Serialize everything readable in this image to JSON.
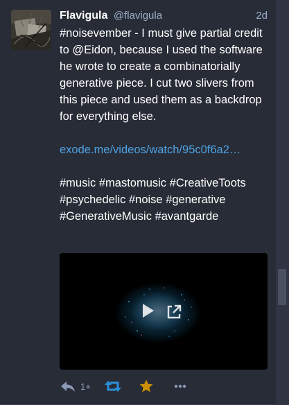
{
  "status": {
    "display_name": "Flavigula",
    "acct": "@flavigula",
    "time": "2d",
    "content": {
      "para1_hashtag": "#noisevember",
      "para1_text_a": " - I must give partial credit to ",
      "para1_mention": "@Eidon",
      "para1_text_b": ", because I used the software he wrote to create a combinatorially generative piece. I cut two slivers from this piece and used them as a backdrop for everything else.",
      "url": "exode.me/videos/watch/95c0f6a2…",
      "tags": [
        "#music",
        "#mastomusic",
        "#CreativeToots",
        "#psychedelic",
        "#noise",
        "#generative",
        "#GenerativeMusic",
        "#avantgarde"
      ]
    },
    "actions": {
      "reply_icon": "reply-icon",
      "reply_count": "1+",
      "boost_icon": "boost-icon",
      "favourite_icon": "star-icon",
      "more_icon": "ellipsis-icon"
    },
    "colors": {
      "background": "#282c37",
      "text": "#ffffff",
      "muted": "#9baec8",
      "link": "#4ea2e2",
      "boost_active": "#2b90d9",
      "favourite_active": "#ca8f04"
    }
  }
}
